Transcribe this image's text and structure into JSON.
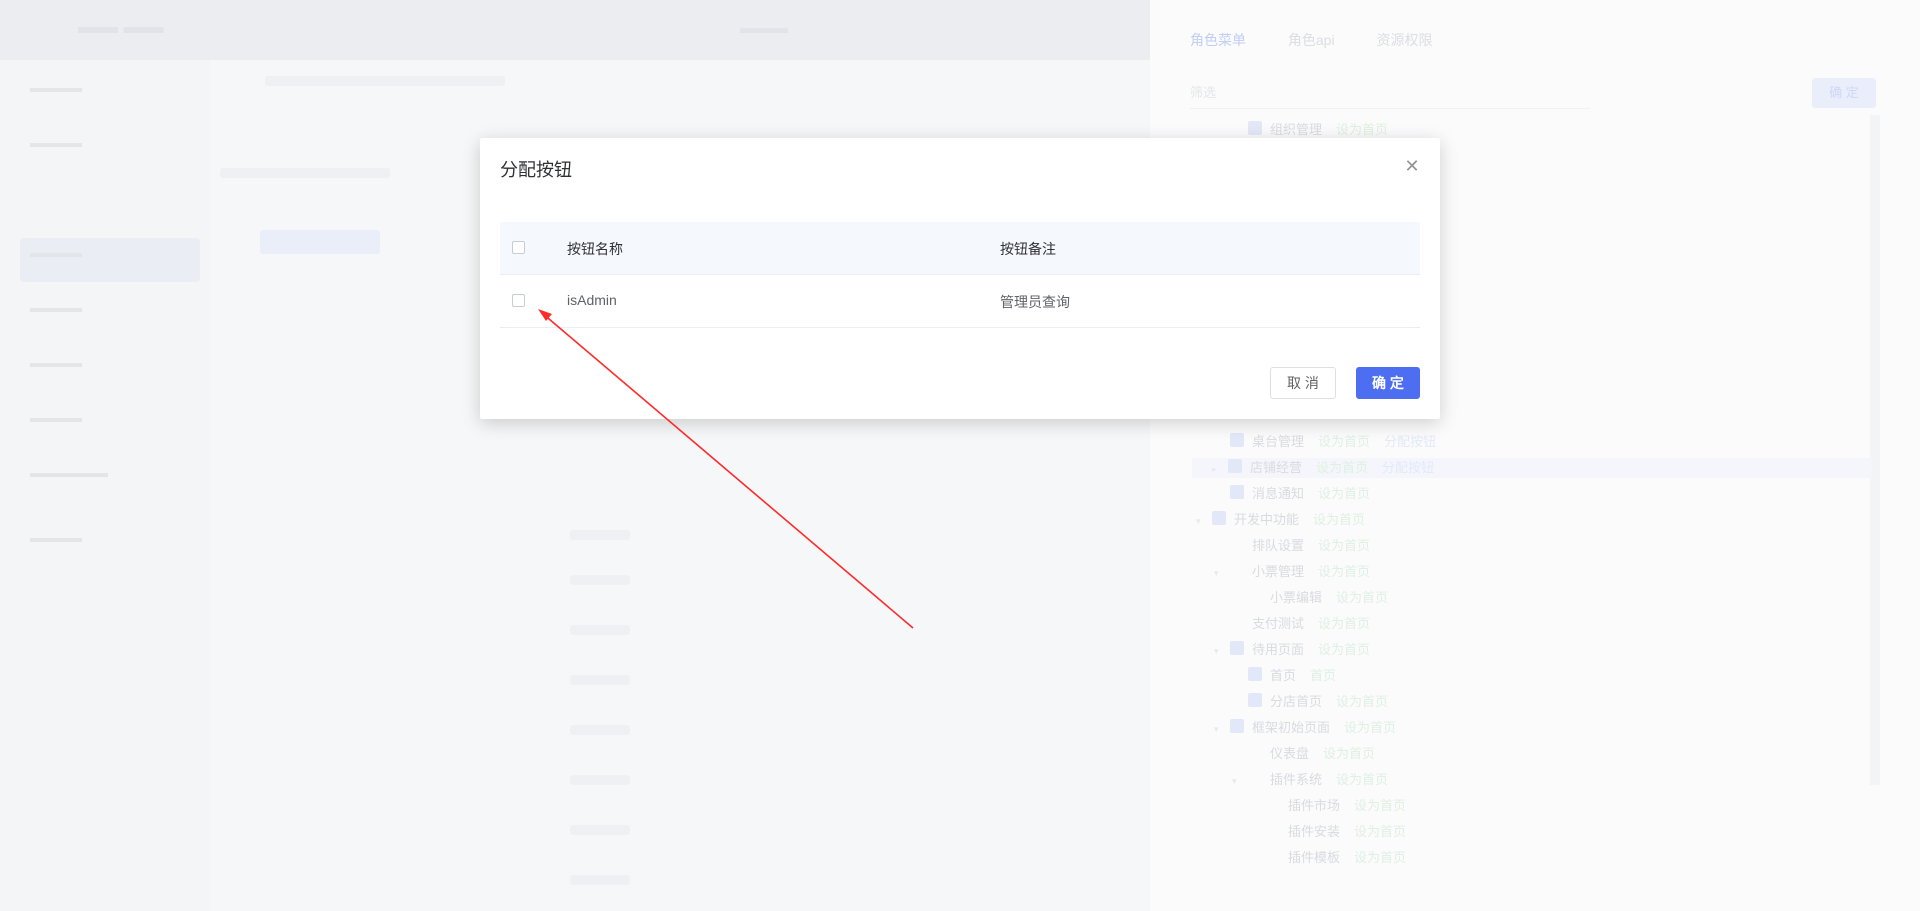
{
  "background": {
    "drawer": {
      "tabs": [
        {
          "label": "角色菜单",
          "active": true
        },
        {
          "label": "角色api",
          "active": false
        },
        {
          "label": "资源权限",
          "active": false
        }
      ],
      "search_placeholder": "筛选",
      "confirm_label": "确 定",
      "tree": [
        {
          "label": "组织管理",
          "checked": true,
          "link": "设为首页"
        },
        {
          "label": "桌台管理",
          "checked": true,
          "link": "设为首页",
          "link2": "分配按钮"
        },
        {
          "label": "店铺经营",
          "checked": true,
          "link": "设为首页",
          "link2": "分配按钮"
        },
        {
          "label": "消息通知",
          "checked": true,
          "link": "设为首页"
        },
        {
          "label": "开发中功能",
          "checked": true,
          "link": "设为首页"
        },
        {
          "label": "排队设置",
          "checked": false,
          "link": "设为首页"
        },
        {
          "label": "小票管理",
          "checked": false,
          "link": "设为首页"
        },
        {
          "label": "小票编辑",
          "checked": false,
          "link": "设为首页"
        },
        {
          "label": "支付测试",
          "checked": false,
          "link": "设为首页"
        },
        {
          "label": "待用页面",
          "checked": true,
          "link": "设为首页"
        },
        {
          "label": "首页",
          "checked": true,
          "link": "首页"
        },
        {
          "label": "分店首页",
          "checked": true,
          "link": "设为首页"
        },
        {
          "label": "框架初始页面",
          "checked": true,
          "link": "设为首页"
        },
        {
          "label": "仪表盘",
          "checked": false,
          "link": "设为首页"
        },
        {
          "label": "插件系统",
          "checked": false,
          "link": "设为首页"
        },
        {
          "label": "插件市场",
          "checked": false,
          "link": "设为首页"
        },
        {
          "label": "插件安装",
          "checked": false,
          "link": "设为首页"
        },
        {
          "label": "插件模板",
          "checked": false,
          "link": "设为首页"
        }
      ]
    }
  },
  "modal": {
    "title": "分配按钮",
    "close_icon": "close-icon",
    "table": {
      "headers": [
        "按钮名称",
        "按钮备注"
      ],
      "rows": [
        {
          "name": "isAdmin",
          "remark": "管理员查询",
          "checked": false
        }
      ]
    },
    "cancel_label": "取 消",
    "ok_label": "确 定"
  },
  "annotation": {
    "type": "arrow",
    "color": "#ff2b2b",
    "points_to": "row-checkbox"
  },
  "colors": {
    "primary": "#4d6ef0",
    "arrow": "#ff2b2b"
  }
}
